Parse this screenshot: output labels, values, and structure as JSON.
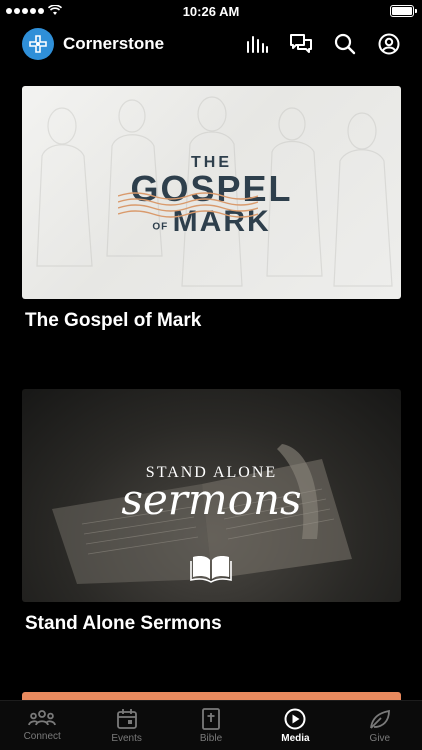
{
  "status_bar": {
    "time": "10:26 AM"
  },
  "header": {
    "app_name": "Cornerstone"
  },
  "cards": [
    {
      "title": "The Gospel of Mark",
      "art_line1": "THE",
      "art_line2": "GOSPEL",
      "art_line3": "OF",
      "art_line4": "MARK"
    },
    {
      "title": "Stand Alone Sermons",
      "art_line1": "STAND ALONE",
      "art_line2": "sermons"
    }
  ],
  "tabs": [
    {
      "label": "Connect",
      "icon": "people-icon"
    },
    {
      "label": "Events",
      "icon": "calendar-icon"
    },
    {
      "label": "Bible",
      "icon": "bible-icon"
    },
    {
      "label": "Media",
      "icon": "play-icon",
      "active": true
    },
    {
      "label": "Give",
      "icon": "leaf-icon"
    }
  ],
  "colors": {
    "brand": "#2f8fd8",
    "background": "#000000",
    "peek_card": "#e98a5e"
  }
}
